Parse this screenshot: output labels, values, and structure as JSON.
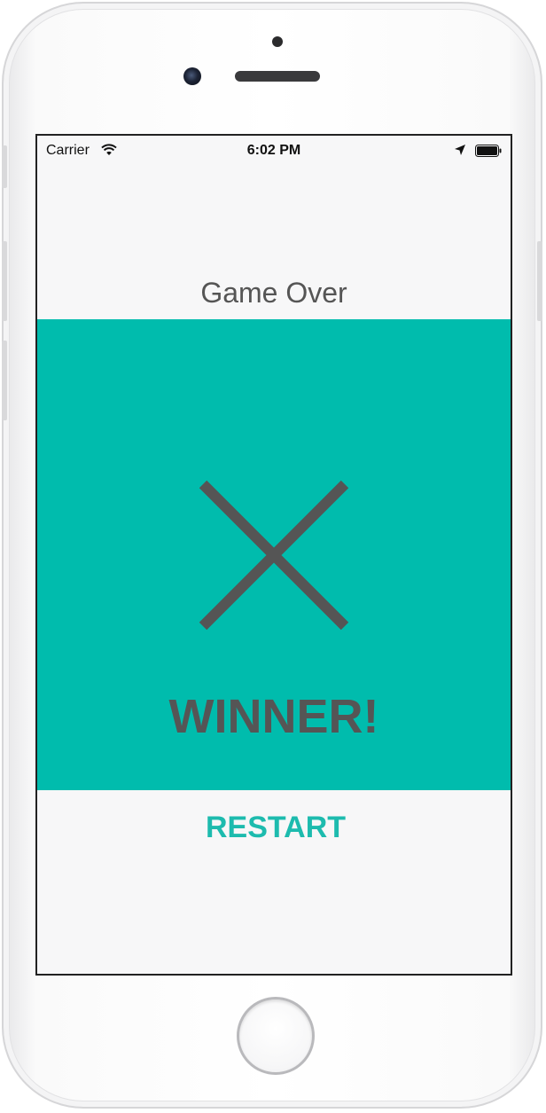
{
  "status_bar": {
    "carrier": "Carrier",
    "time": "6:02 PM",
    "wifi_icon": "wifi-icon",
    "location_icon": "location-arrow-icon",
    "battery_icon": "battery-icon"
  },
  "game": {
    "title": "Game Over",
    "winner_mark": "X",
    "winner_mark_icon": "x-mark-icon",
    "result_text": "WINNER!",
    "restart_label": "RESTART"
  },
  "colors": {
    "accent": "#00bcad",
    "restart_text": "#1dbbae",
    "mark": "#555555",
    "screen_background": "#f7f7f8"
  }
}
